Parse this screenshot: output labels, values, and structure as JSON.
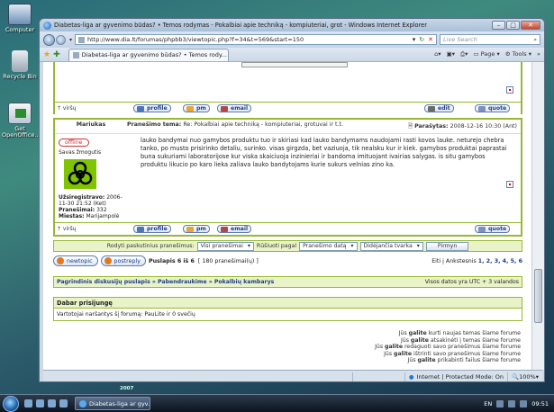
{
  "desktop": {
    "icons": [
      {
        "label": "Computer"
      },
      {
        "label": "Recycle Bin"
      },
      {
        "label": "Get OpenOffice..."
      }
    ]
  },
  "window": {
    "title": "Diabetas-liga ar gyvenimo būdas? • Temos rodymas - Pokalbiai apie techniką - kompiuteriai, grot - Windows Internet Explorer",
    "url": "http://www.dia.lt/forumas/phpbb3/viewtopic.php?f=34&t=569&start=150",
    "search_placeholder": "Live Search",
    "tab_label": "Diabetas-liga ar gyvenimo būdas? • Temos rody...",
    "tools": {
      "page": "Page",
      "tools": "Tools"
    }
  },
  "post_top": {
    "up_label": "↑ viršų",
    "buttons": {
      "profile": "profile",
      "pm": "pm",
      "email": "email",
      "edit": "edit",
      "quote": "quote"
    }
  },
  "post": {
    "author": "Mariukas",
    "subject_prefix": "Pranešimo tema:",
    "subject": "Re: Pokalbiai apie techniką - kompiuteriai, grotuvai ir t.t.",
    "posted_prefix": "Parašytas:",
    "posted": "2008-12-16 10:30 (Ant)",
    "status": "offline",
    "rank": "Savas žmogutis",
    "registered_label": "Užsiregistravo:",
    "registered": "2006-11-30 21:52 (Ket)",
    "posts_label": "Pranešimai:",
    "posts": "332",
    "city_label": "Miestas:",
    "city": "Marijampolė",
    "text": "lauko bandymai nuo gamybos produktu tuo ir skiriasi kad lauko bandymams naudojami rasti kovos lauke. neturejo chebra tanko, po musto prisirinko detaliu, surinko. visas girgzda, bet vaziuoja, tik nealsku kur ir kiek. gamybos produktai paprastai buna sukuriami laboratorijose kur viska skaiciuoja inzinieriai ir bandoma imituojant ivairias salygas. is situ gamybos produktu likucio po karo lieka zaliava lauko bandytojams kurie sukurs velnias zino ka.",
    "up_label": "↑ viršų"
  },
  "sort": {
    "show_label": "Rodyti paskutinius pranešimus:",
    "show_value": "Visi pranešimai",
    "sort_label": "Rūšiuoti pagal",
    "sort_value": "Pranešimo datą",
    "order_value": "Didėjančia tvarka",
    "go_label": "Pirmyn"
  },
  "pagination": {
    "new_topic": "newtopic",
    "post_reply": "postreply",
    "page_info": "Puslapis 6 iš 6",
    "count": "[ 180 pranešimai(ų) ]",
    "goto": "Eiti į Ankstesnis",
    "pages": "1, 2, 3, 4, 5, 6"
  },
  "breadcrumb": {
    "path": "Pagrindinis diskusijų puslapis » Pabendraukime » Pokalbių kambarys",
    "timezone": "Visos datos yra UTC + 3 valandos"
  },
  "online": {
    "title": "Dabar prisijungę",
    "text": "Vartotojai naršantys šį forumą: PauLite ir 0 svečių"
  },
  "permissions": [
    {
      "prefix": "Jūs",
      "verb": "galite",
      "rest": "kurti naujas temas šiame forume"
    },
    {
      "prefix": "Jūs",
      "verb": "galite",
      "rest": "atsakinėti į temas šiame forume"
    },
    {
      "prefix": "Jūs",
      "verb": "galite",
      "rest": "redaguoti savo pranešimus šiame forume"
    },
    {
      "prefix": "Jūs",
      "verb": "galite",
      "rest": "ištrinti savo pranešimus šiame forume"
    },
    {
      "prefix": "Jūs",
      "verb": "galite",
      "rest": "prikabinti failus šiame forume"
    }
  ],
  "statusbar": {
    "zone": "Internet | Protected Mode: On",
    "zoom": "100%"
  },
  "taskbar": {
    "task": "Diabetas-liga ar gyv...",
    "lang": "EN",
    "clock": "09:51",
    "label": "2007"
  },
  "colors": {
    "forum_green": "#96b832",
    "bar_bg": "#eaf3c7",
    "link_blue": "#1d3c8c",
    "offline_red": "#cc3333"
  }
}
